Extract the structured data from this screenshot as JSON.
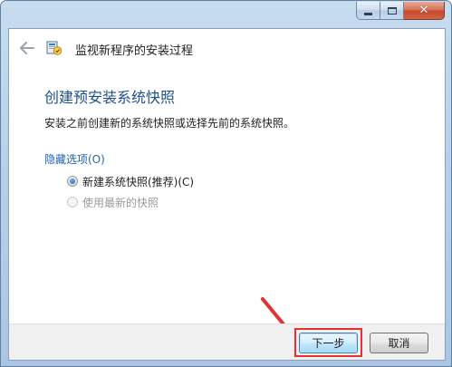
{
  "window": {
    "title": "监视新程序的安装过程",
    "caption_buttons": [
      "minimize-icon",
      "maximize-icon",
      "close-icon"
    ],
    "close_glyph": "✕"
  },
  "header": {
    "back_icon": "back-arrow-icon",
    "app_icon": "monitor-install-icon"
  },
  "content": {
    "heading": "创建预安装系统快照",
    "description": "安装之前创建新的系统快照或选择先前的系统快照。",
    "options_label": "隐藏选项(O)",
    "options": [
      {
        "label": "新建系统快照(推荐)(C)",
        "selected": true,
        "enabled": true
      },
      {
        "label": "使用最新的快照",
        "selected": false,
        "enabled": false
      }
    ]
  },
  "buttons": {
    "next": "下一步",
    "cancel": "取消"
  },
  "colors": {
    "heading": "#1f4e8c",
    "link": "#1f62b5",
    "annotation": "#e8312f"
  }
}
